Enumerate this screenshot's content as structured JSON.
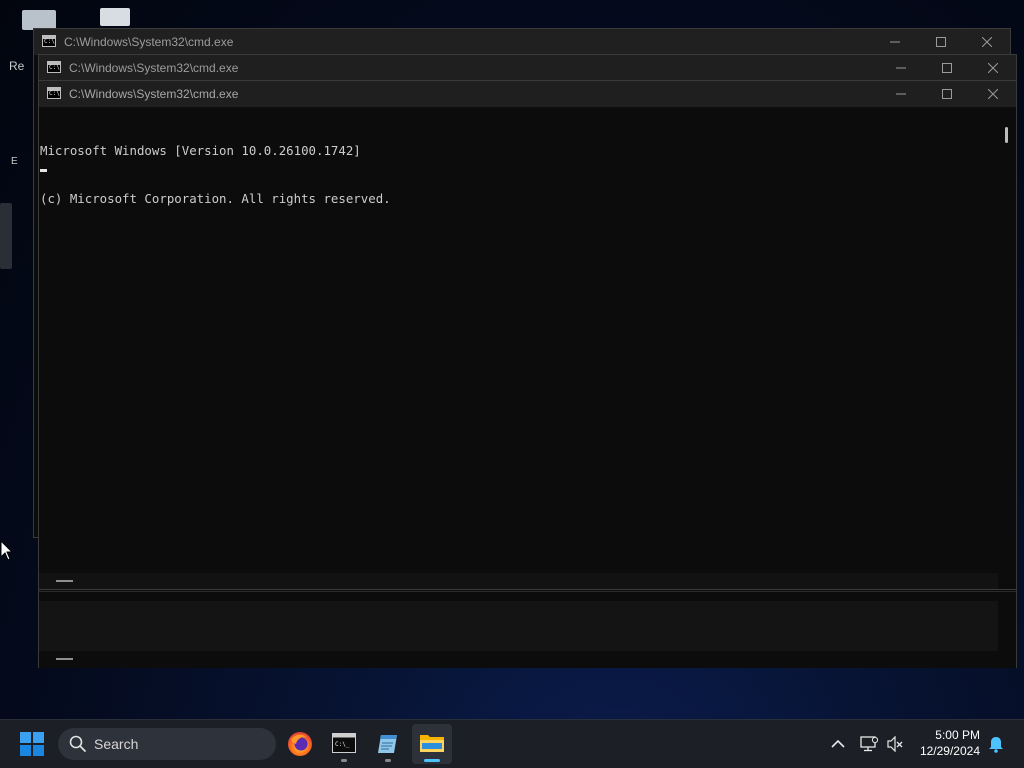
{
  "desktop": {
    "icon_labels": [
      "Re",
      "E"
    ]
  },
  "windows": [
    {
      "title": "C:\\Windows\\System32\\cmd.exe",
      "minimize_glyph": "—",
      "maximize_glyph": "☐",
      "close_glyph": "✕"
    },
    {
      "title": "C:\\Windows\\System32\\cmd.exe",
      "minimize_glyph": "—",
      "maximize_glyph": "☐",
      "close_glyph": "✕"
    },
    {
      "title": "C:\\Windows\\System32\\cmd.exe",
      "minimize_glyph": "—",
      "maximize_glyph": "☐",
      "close_glyph": "✕",
      "console_lines": [
        "Microsoft Windows [Version 10.0.26100.1742]",
        "(c) Microsoft Corporation. All rights reserved."
      ]
    }
  ],
  "taskbar": {
    "search_label": "Search",
    "apps": [
      {
        "name": "firefox",
        "icon": "firefox-icon",
        "running": false
      },
      {
        "name": "command-prompt",
        "icon": "terminal-icon",
        "running": true
      },
      {
        "name": "notepad",
        "icon": "notepad-icon",
        "running": true
      },
      {
        "name": "file-explorer",
        "icon": "folder-icon",
        "running": true,
        "active": true
      }
    ],
    "tray": {
      "time": "5:00 PM",
      "date": "12/29/2024"
    }
  },
  "colors": {
    "console_bg": "#0c0c0c",
    "console_text": "#cccccc",
    "titlebar_bg": "#1f1f1f",
    "taskbar_bg": "#1c1f26",
    "accent": "#4cc2ff",
    "start_blue": "#0a84d6"
  }
}
